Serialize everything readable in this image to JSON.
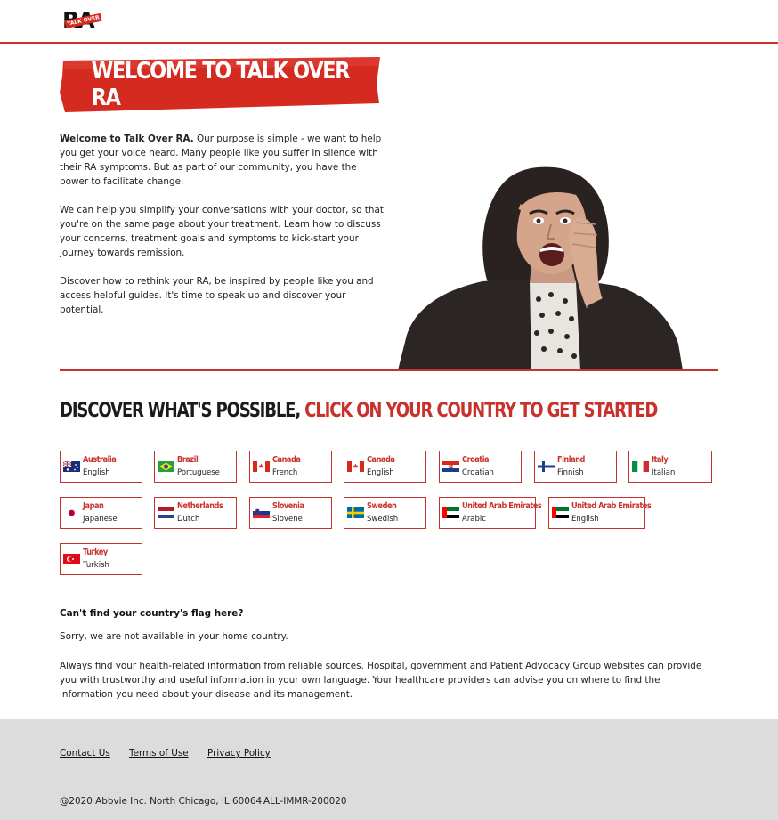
{
  "header": {
    "logo_text": "RA",
    "logo_tag": "TALK OVER"
  },
  "banner": {
    "title": "WELCOME TO TALK OVER RA"
  },
  "intro": {
    "p1_bold": "Welcome to Talk Over RA.",
    "p1_text": " Our purpose is simple - we want to help you get your voice heard. Many people  like you suffer in silence with their RA symptoms. But as part of our community, you have  the power to facilitate change.",
    "p2": "We can help you simplify your conversations with your doctor, so that you're on the same page about your treatment. Learn how to discuss your concerns, treatment goals and symptoms to kick-start your journey towards remission.",
    "p3": "Discover how to rethink your RA, be inspired by people like you and access helpful guides. It's time to speak up and discover your potential."
  },
  "discover": {
    "part1": "DISCOVER WHAT'S POSSIBLE, ",
    "part2": "CLICK ON YOUR COUNTRY TO GET STARTED"
  },
  "countries": [
    {
      "name": "Australia",
      "language": "English",
      "flag": "australia-flag"
    },
    {
      "name": "Brazil",
      "language": "Portuguese",
      "flag": "brazil-flag"
    },
    {
      "name": "Canada",
      "language": "French",
      "flag": "canada-flag"
    },
    {
      "name": "Canada",
      "language": "English",
      "flag": "canada-flag"
    },
    {
      "name": "Croatia",
      "language": "Croatian",
      "flag": "croatia-flag"
    },
    {
      "name": "Finland",
      "language": "Finnish",
      "flag": "finland-flag"
    },
    {
      "name": "Italy",
      "language": "Italian",
      "flag": "italy-flag"
    },
    {
      "name": "Japan",
      "language": "Japanese",
      "flag": "japan-flag"
    },
    {
      "name": "Netherlands",
      "language": "Dutch",
      "flag": "netherlands-flag"
    },
    {
      "name": "Slovenia",
      "language": "Slovene",
      "flag": "slovenia-flag"
    },
    {
      "name": "Sweden",
      "language": "Swedish",
      "flag": "sweden-flag"
    },
    {
      "name": "United Arab Emirates",
      "language": "Arabic",
      "flag": "uae-flag"
    },
    {
      "name": "United Arab Emirates",
      "language": "English",
      "flag": "uae-flag"
    },
    {
      "name": "Turkey",
      "language": "Turkish",
      "flag": "turkey-flag"
    }
  ],
  "notice": {
    "heading": "Can't find your country's flag here?",
    "sorry": "Sorry, we are not available in your home country.",
    "always": "Always find your health-related information from reliable sources. Hospital, government and Patient Advocacy Group websites can provide you with trustworthy and useful information in your own language. Your healthcare providers can advise you on where to find the information you need about your disease and its management."
  },
  "footer": {
    "links": [
      "Contact Us",
      "Terms of Use",
      "Privacy Policy"
    ],
    "copyright": "@2020 Abbvie Inc. North Chicago, IL 60064.",
    "code": "ALL-IMMR-200020"
  },
  "colors": {
    "accent": "#c8322d",
    "footer_bg": "#dcdcdc"
  }
}
